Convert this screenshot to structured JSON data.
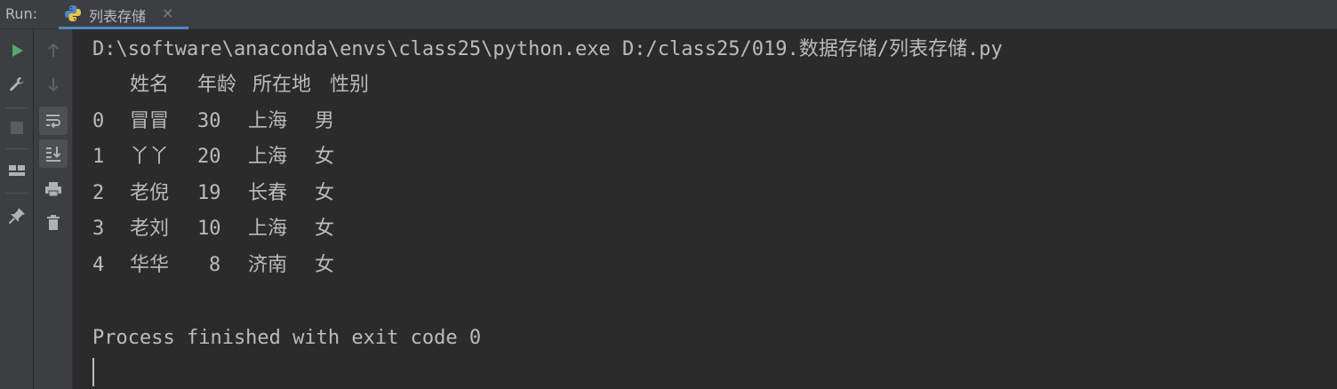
{
  "run_bar": {
    "label": "Run:",
    "tab_label": "列表存储",
    "tab_close": "×"
  },
  "left_toolbar": [
    "run-icon",
    "wrench-icon",
    "stop-icon",
    "layout-icon",
    "pin-icon"
  ],
  "right_toolbar": [
    "arrow-up-icon",
    "arrow-down-icon",
    "soft-wrap-icon",
    "scroll-to-end-icon",
    "print-icon",
    "trash-icon"
  ],
  "console": {
    "command": "D:\\software\\anaconda\\envs\\class25\\python.exe D:/class25/019.数据存储/列表存储.py",
    "table": {
      "headers": [
        "姓名",
        "年龄",
        "所在地",
        "性别"
      ],
      "rows": [
        {
          "index": "0",
          "name": "冒冒",
          "age": "30",
          "city": "上海",
          "gender": "男"
        },
        {
          "index": "1",
          "name": "丫丫",
          "age": "20",
          "city": "上海",
          "gender": "女"
        },
        {
          "index": "2",
          "name": "老倪",
          "age": "19",
          "city": "长春",
          "gender": "女"
        },
        {
          "index": "3",
          "name": "老刘",
          "age": "10",
          "city": "上海",
          "gender": "女"
        },
        {
          "index": "4",
          "name": "华华",
          "age": "8",
          "city": "济南",
          "gender": "女"
        }
      ]
    },
    "exit_message": "Process finished with exit code 0"
  }
}
